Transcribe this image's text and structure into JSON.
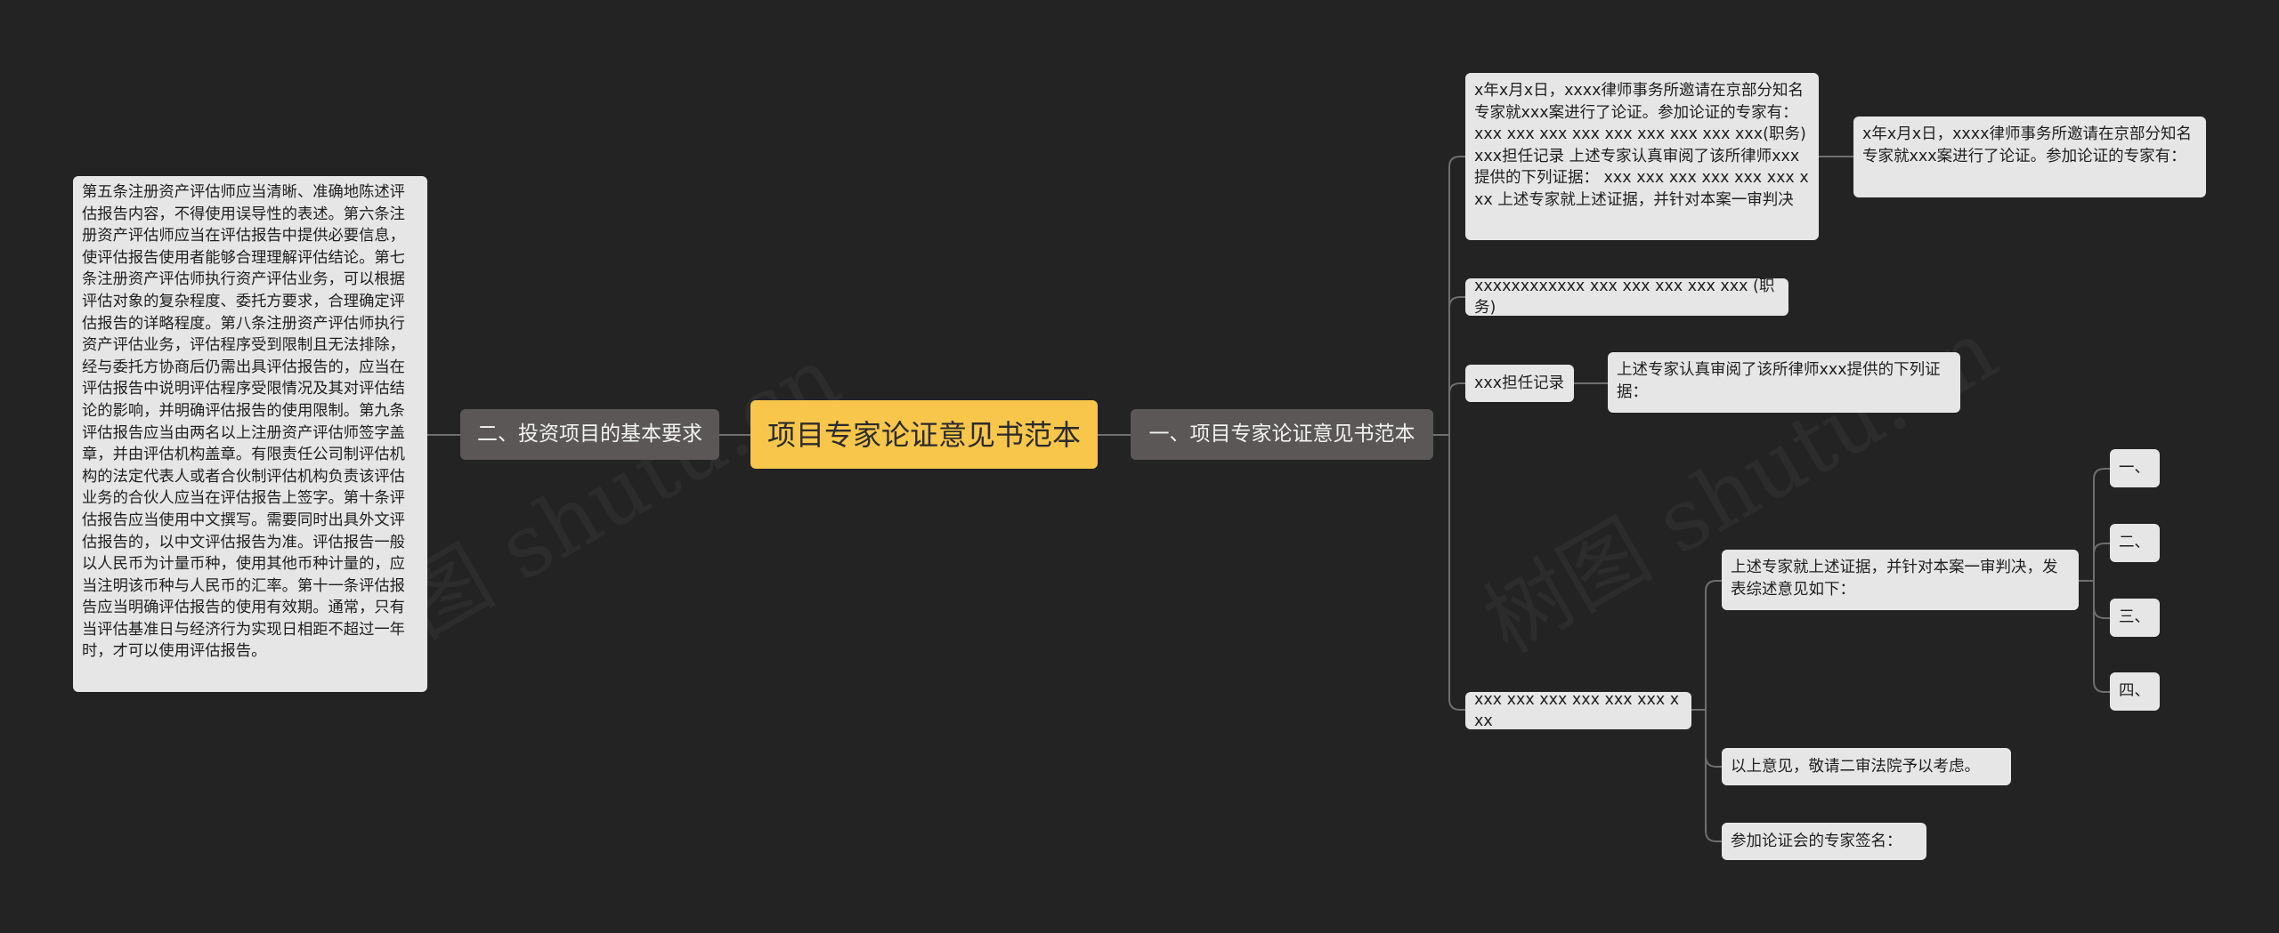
{
  "root": {
    "label": "项目专家论证意见书范本"
  },
  "left_branch": {
    "label": "二、投资项目的基本要求",
    "paragraph": "第五条注册资产评估师应当清晰、准确地陈述评估报告内容，不得使用误导性的表述。第六条注册资产评估师应当在评估报告中提供必要信息，使评估报告使用者能够合理理解评估结论。第七条注册资产评估师执行资产评估业务，可以根据评估对象的复杂程度、委托方要求，合理确定评估报告的详略程度。第八条注册资产评估师执行资产评估业务，评估程序受到限制且无法排除，经与委托方协商后仍需出具评估报告的，应当在评估报告中说明评估程序受限情况及其对评估结论的影响，并明确评估报告的使用限制。第九条评估报告应当由两名以上注册资产评估师签字盖章，并由评估机构盖章。有限责任公司制评估机构的法定代表人或者合伙制评估机构负责该评估业务的合伙人应当在评估报告上签字。第十条评估报告应当使用中文撰写。需要同时出具外文评估报告的，以中文评估报告为准。评估报告一般以人民币为计量币种，使用其他币种计量的，应当注明该币种与人民币的汇率。第十一条评估报告应当明确评估报告的使用有效期。通常，只有当评估基准日与经济行为实现日相距不超过一年时，才可以使用评估报告。"
  },
  "right_branch": {
    "label": "一、项目专家论证意见书范本",
    "item1": {
      "text": "x年x月x日，xxxx律师事务所邀请在京部分知名专家就xxx案进行了论证。参加论证的专家有： xxx xxx xxx xxx xxx xxx xxx xxx xxx(职务) xxx担任记录 上述专家认真审阅了该所律师xxx提供的下列证据： xxx xxx xxx xxx xxx xxx xxx 上述专家就上述证据，并针对本案一审判决",
      "child": "x年x月x日，xxxx律师事务所邀请在京部分知名专家就xxx案进行了论证。参加论证的专家有："
    },
    "item2": {
      "text": "xxxxxxxxxxxx xxx xxx xxx xxx xxx (职务)"
    },
    "item3": {
      "text": "xxx担任记录",
      "child": "上述专家认真审阅了该所律师xxx提供的下列证据："
    },
    "item4": {
      "text": "xxx xxx xxx xxx xxx xxx xxx",
      "opinion": "上述专家就上述证据，并针对本案一审判决，发表综述意见如下：",
      "points": [
        "一、",
        "二、",
        "三、",
        "四、"
      ],
      "closing": "以上意见，敬请二审法院予以考虑。",
      "signature": "参加论证会的专家签名："
    }
  },
  "colors": {
    "background": "#232323",
    "root": "#f7c64b",
    "branch": "#5a5756",
    "leaf": "#e6e6e6",
    "link": "#6e6e6e"
  }
}
